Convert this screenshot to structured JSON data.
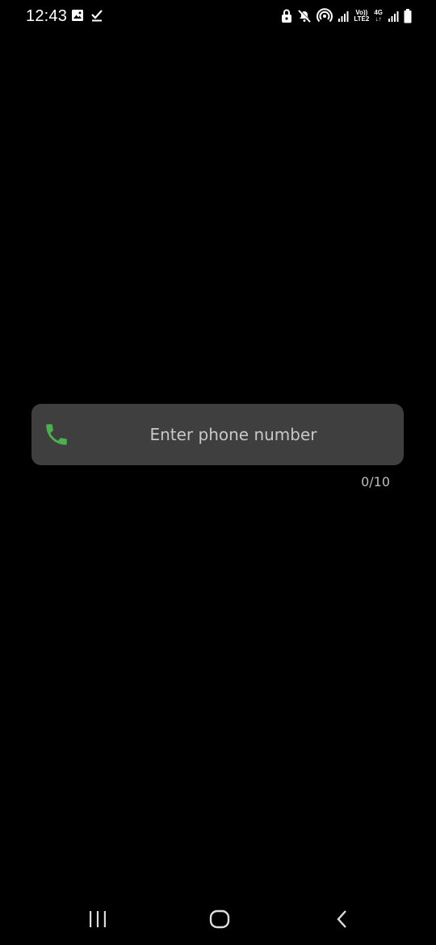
{
  "status_bar": {
    "time": "12:43",
    "left_icons": [
      "image-icon",
      "checkmark-icon"
    ],
    "right_icons": [
      "lock-icon",
      "mute-icon",
      "hotspot-icon",
      "signal-icon",
      "volte-icon",
      "4g-icon",
      "signal-icon",
      "battery-icon"
    ],
    "volte_top": "Vo))",
    "volte_bottom": "LTE2",
    "net_top": "4G",
    "net_bottom": "↓↑"
  },
  "phone_field": {
    "icon": "phone-icon",
    "icon_color": "#4caf50",
    "placeholder": "Enter phone number",
    "value": "",
    "counter": "0/10"
  },
  "nav_bar": {
    "recents_icon": "recents-icon",
    "home_icon": "home-icon",
    "back_icon": "back-icon"
  }
}
